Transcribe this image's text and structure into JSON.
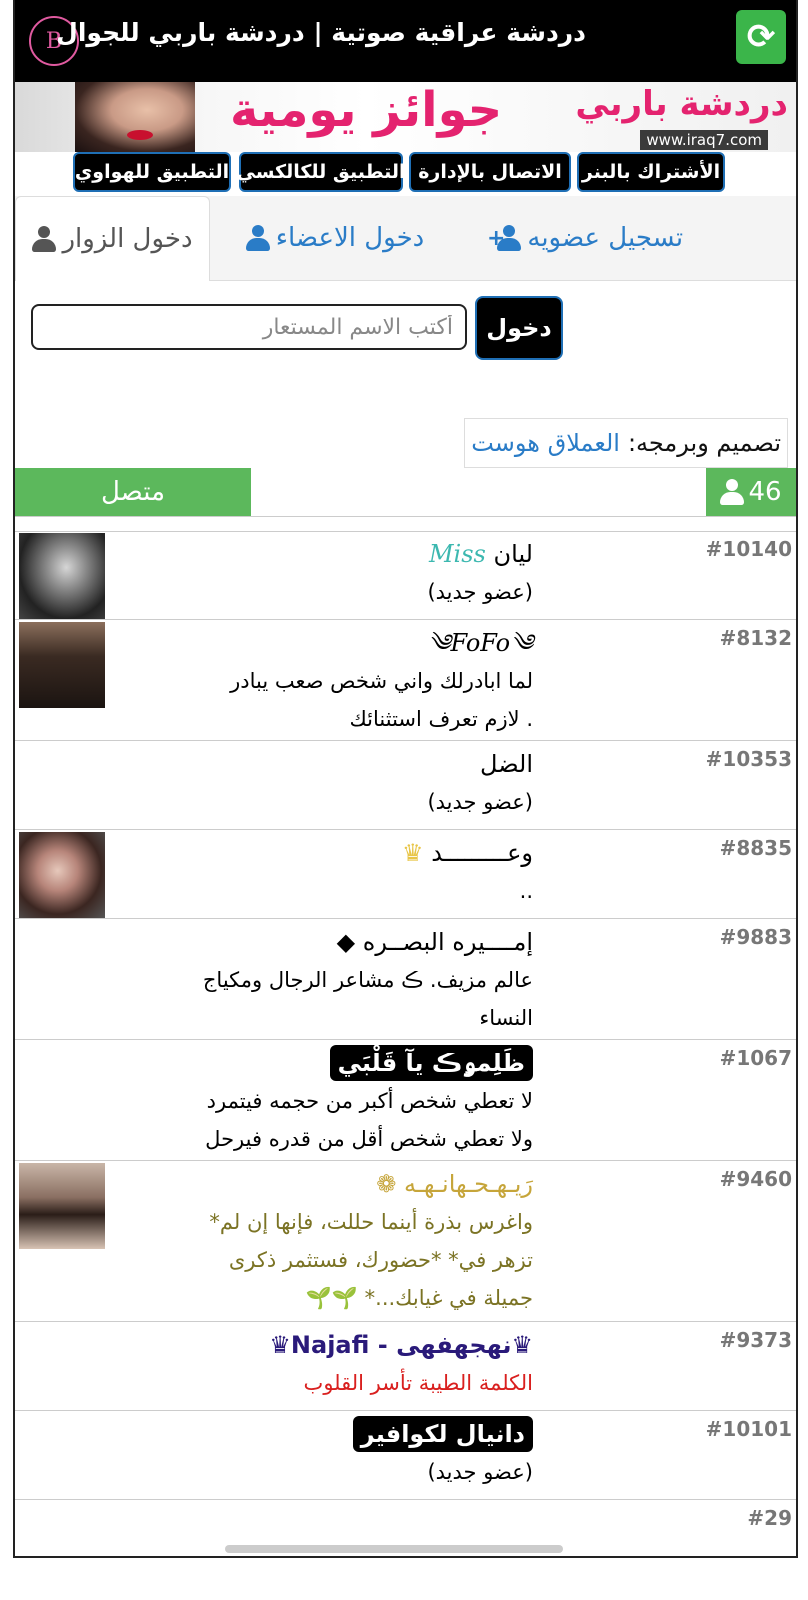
{
  "header": {
    "title": "دردشة عراقية صوتية | دردشة باربي للجوال"
  },
  "banner": {
    "brand": "دردشة باربي",
    "prizes": "جوائز يومية",
    "url": "www.iraq7.com"
  },
  "nav": {
    "banner_sub": "الأشتراك بالبنر",
    "contact_admin": "الاتصال بالإدارة",
    "classic_app": "التطبيق للكالكسي",
    "huawei_app": "التطبيق للهواوي"
  },
  "tabs": {
    "register": "تسجيل عضويه",
    "members_login": "دخول الاعضاء",
    "guest_login": "دخول الزوار"
  },
  "login": {
    "placeholder": "أكتب الاسم المستعار",
    "enter": "دخول"
  },
  "credit": {
    "label": "تصميم وبرمجه:",
    "link": "العملاق هوست"
  },
  "status": {
    "online": "متصل",
    "count": "46"
  },
  "users": [
    {
      "id": "#10140",
      "name": "ليان",
      "prefix": "Miss",
      "status": "(عضو جديد)"
    },
    {
      "id": "#8132",
      "name": "༄FoFo༄",
      "status1": "لما ابادرلك واني شخص صعب يبادر",
      "status2": ". لازم تعرف استثنائك"
    },
    {
      "id": "#10353",
      "name": "الضل",
      "status": "(عضو جديد)"
    },
    {
      "id": "#8835",
      "name": "وعـــــــــد",
      "status": ".."
    },
    {
      "id": "#9883",
      "name": "إمــــيره البصــره",
      "status1": "عالم مزيف. ڪ مشاعر الرجال ومكياج",
      "status2": "النساء"
    },
    {
      "id": "#1067",
      "name": "ظَلِمۅڪ يآ قَلْبَي",
      "status1": "لا تعطي شخص أكبر من حجمه فيتمرد",
      "status2": "ولا تعطي شخص أقل من قدره فيرحل"
    },
    {
      "id": "#9460",
      "name": "رَيـهـحـهانـهـه",
      "status1": "واغرس بذرة أينما حللت، فإنها إن لم*",
      "status2": "تزهر في* *حضورك، فستثمر ذكرى",
      "status3": "جميلة في غيابك...* 🌱🌱"
    },
    {
      "id": "#9373",
      "name": "♛نهجهفهى - Najafi♛",
      "status": "الكلمة الطيبة تأسر القلوب"
    },
    {
      "id": "#10101",
      "name": "دانيال لكوافير",
      "status": "(عضو جديد)"
    },
    {
      "id": "#29"
    }
  ]
}
